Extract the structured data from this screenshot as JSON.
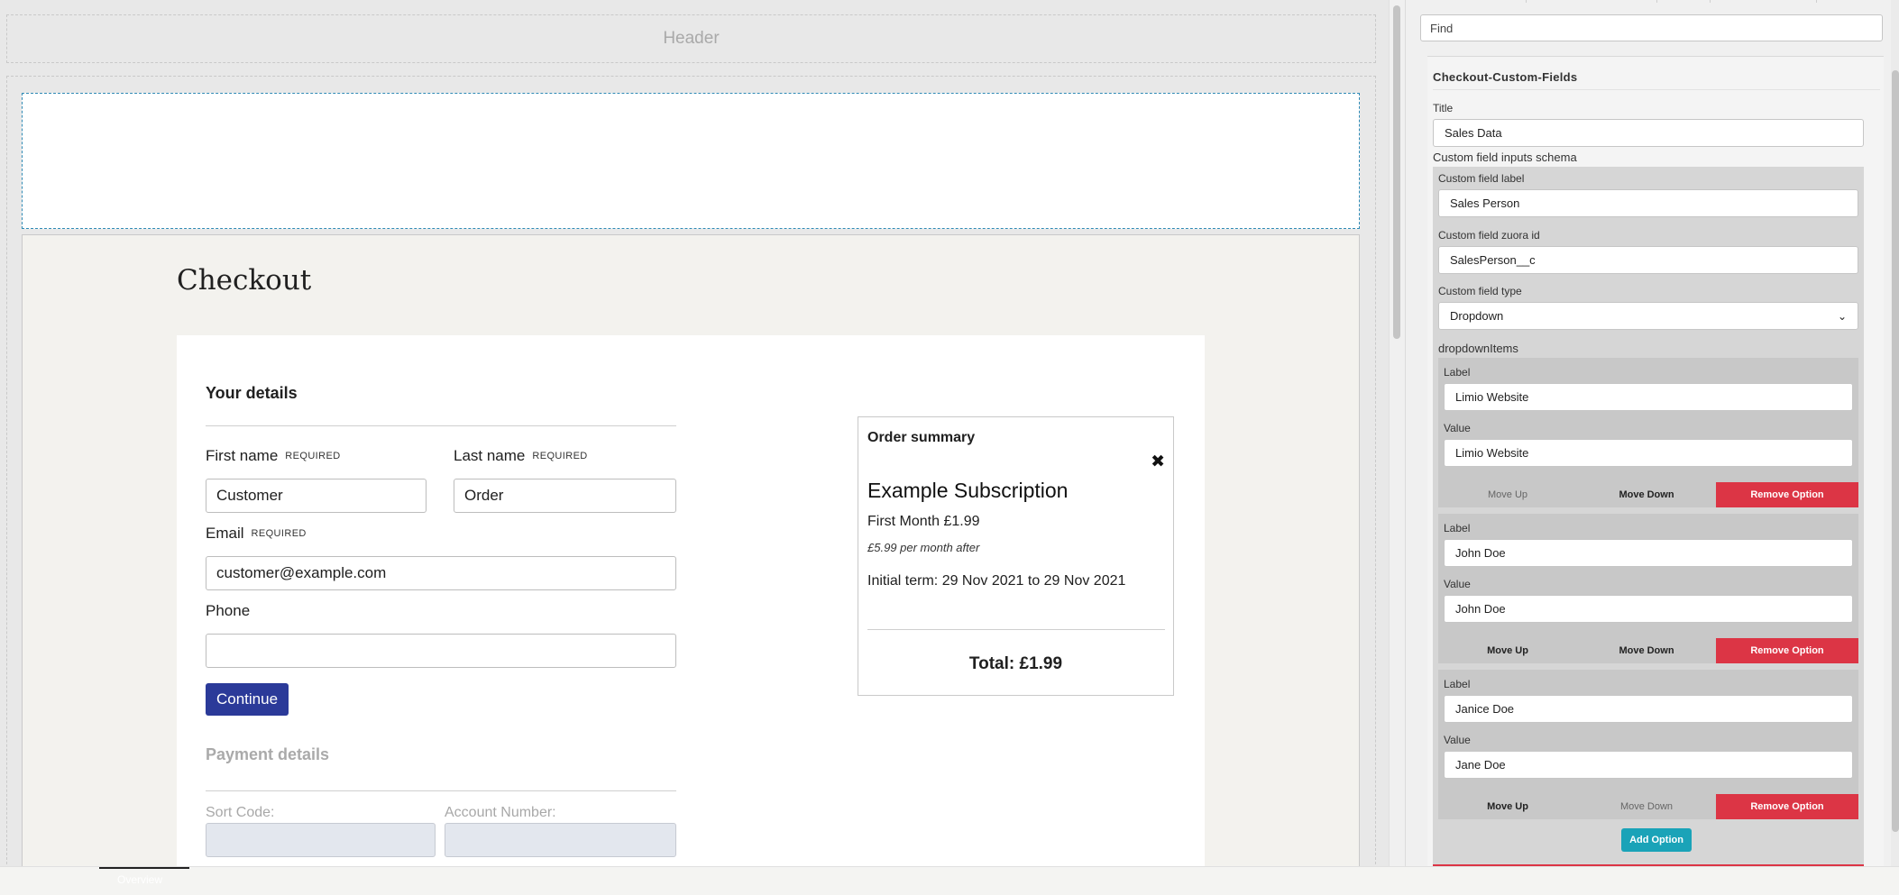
{
  "canvas": {
    "header_zone_label": "Header"
  },
  "checkout": {
    "title": "Checkout",
    "details_title": "Your details",
    "required_tag": "REQUIRED",
    "first_name_label": "First name",
    "first_name_value": "Customer",
    "last_name_label": "Last name",
    "last_name_value": "Order",
    "email_label": "Email",
    "email_value": "customer@example.com",
    "phone_label": "Phone",
    "phone_value": "",
    "continue_label": "Continue",
    "payment_title": "Payment details",
    "sort_code_label": "Sort Code:",
    "account_number_label": "Account Number:"
  },
  "summary": {
    "title": "Order summary",
    "close_icon": "close-icon",
    "close_glyph": "✖",
    "product": "Example Subscription",
    "first_month": "First Month £1.99",
    "after": "£5.99 per month after",
    "term": "Initial term: 29 Nov 2021 to 29 Nov 2021",
    "total": "Total: £1.99"
  },
  "bottom_bar": {
    "tab_label": "Overview"
  },
  "panel": {
    "find_placeholder": "Find",
    "component_title": "Checkout-Custom-Fields",
    "title_label": "Title",
    "title_value": "Sales Data",
    "schema_label": "Custom field inputs schema",
    "field_label_label": "Custom field label",
    "field_label_value": "Sales Person",
    "zuora_id_label": "Custom field zuora id",
    "zuora_id_value": "SalesPerson__c",
    "type_label": "Custom field type",
    "type_value": "Dropdown",
    "dropdown_items_label": "dropdownItems",
    "item_label_label": "Label",
    "item_value_label": "Value",
    "move_up_label": "Move Up",
    "move_down_label": "Move Down",
    "remove_label": "Remove Option",
    "add_label": "Add Option",
    "dropdown_items": [
      {
        "label": "Limio Website",
        "value": "Limio Website"
      },
      {
        "label": "John Doe",
        "value": "John Doe"
      },
      {
        "label": "Janice Doe",
        "value": "Jane Doe"
      }
    ]
  },
  "colors": {
    "continue_button": "#2b3a99",
    "remove_button": "#dc3545",
    "add_button": "#1aa3b8",
    "drop_zone_border": "#2f8ab5"
  }
}
